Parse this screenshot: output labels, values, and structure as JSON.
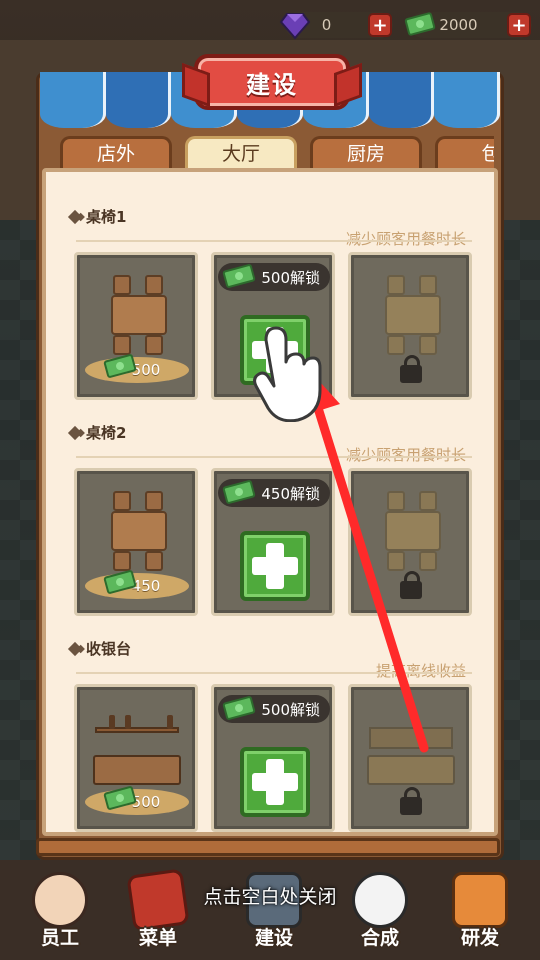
{
  "currency": {
    "gems": {
      "icon": "gem-icon",
      "value": "0",
      "add_label": "+"
    },
    "cash": {
      "icon": "cash-icon",
      "value": "2000",
      "add_label": "+"
    }
  },
  "panel": {
    "title": "建设",
    "tabs": [
      {
        "label": "店外",
        "active": false
      },
      {
        "label": "大厅",
        "active": true
      },
      {
        "label": "厨房",
        "active": false
      },
      {
        "label": "包",
        "active": false
      }
    ],
    "sections": [
      {
        "title": "桌椅1",
        "description": "减少顾客用餐时长",
        "slots": [
          {
            "state": "owned",
            "price": "500"
          },
          {
            "state": "unlockable",
            "unlock_label": "500解锁"
          },
          {
            "state": "locked"
          }
        ]
      },
      {
        "title": "桌椅2",
        "description": "减少顾客用餐时长",
        "slots": [
          {
            "state": "owned",
            "price": "450"
          },
          {
            "state": "unlockable",
            "unlock_label": "450解锁"
          },
          {
            "state": "locked"
          }
        ]
      },
      {
        "title": "收银台",
        "description": "提高离线收益",
        "slots": [
          {
            "state": "owned",
            "price": "500"
          },
          {
            "state": "unlockable",
            "unlock_label": "500解锁"
          },
          {
            "state": "locked"
          }
        ]
      }
    ]
  },
  "close_hint": "点击空白处关闭",
  "bottom_nav": [
    {
      "label": "员工",
      "icon": "chef-avatar-icon",
      "active": false
    },
    {
      "label": "菜单",
      "icon": "menu-book-icon",
      "active": false
    },
    {
      "label": "建设",
      "icon": "hammer-icon",
      "active": true
    },
    {
      "label": "合成",
      "icon": "onigiri-icon",
      "active": false
    },
    {
      "label": "研发",
      "icon": "sushi-icon",
      "active": false
    }
  ],
  "colors": {
    "accent_red": "#e24c43",
    "awning_blue": "#3f8fcf",
    "plus_green": "#4faa3c",
    "tutorial_arrow": "#ff2a2a"
  }
}
